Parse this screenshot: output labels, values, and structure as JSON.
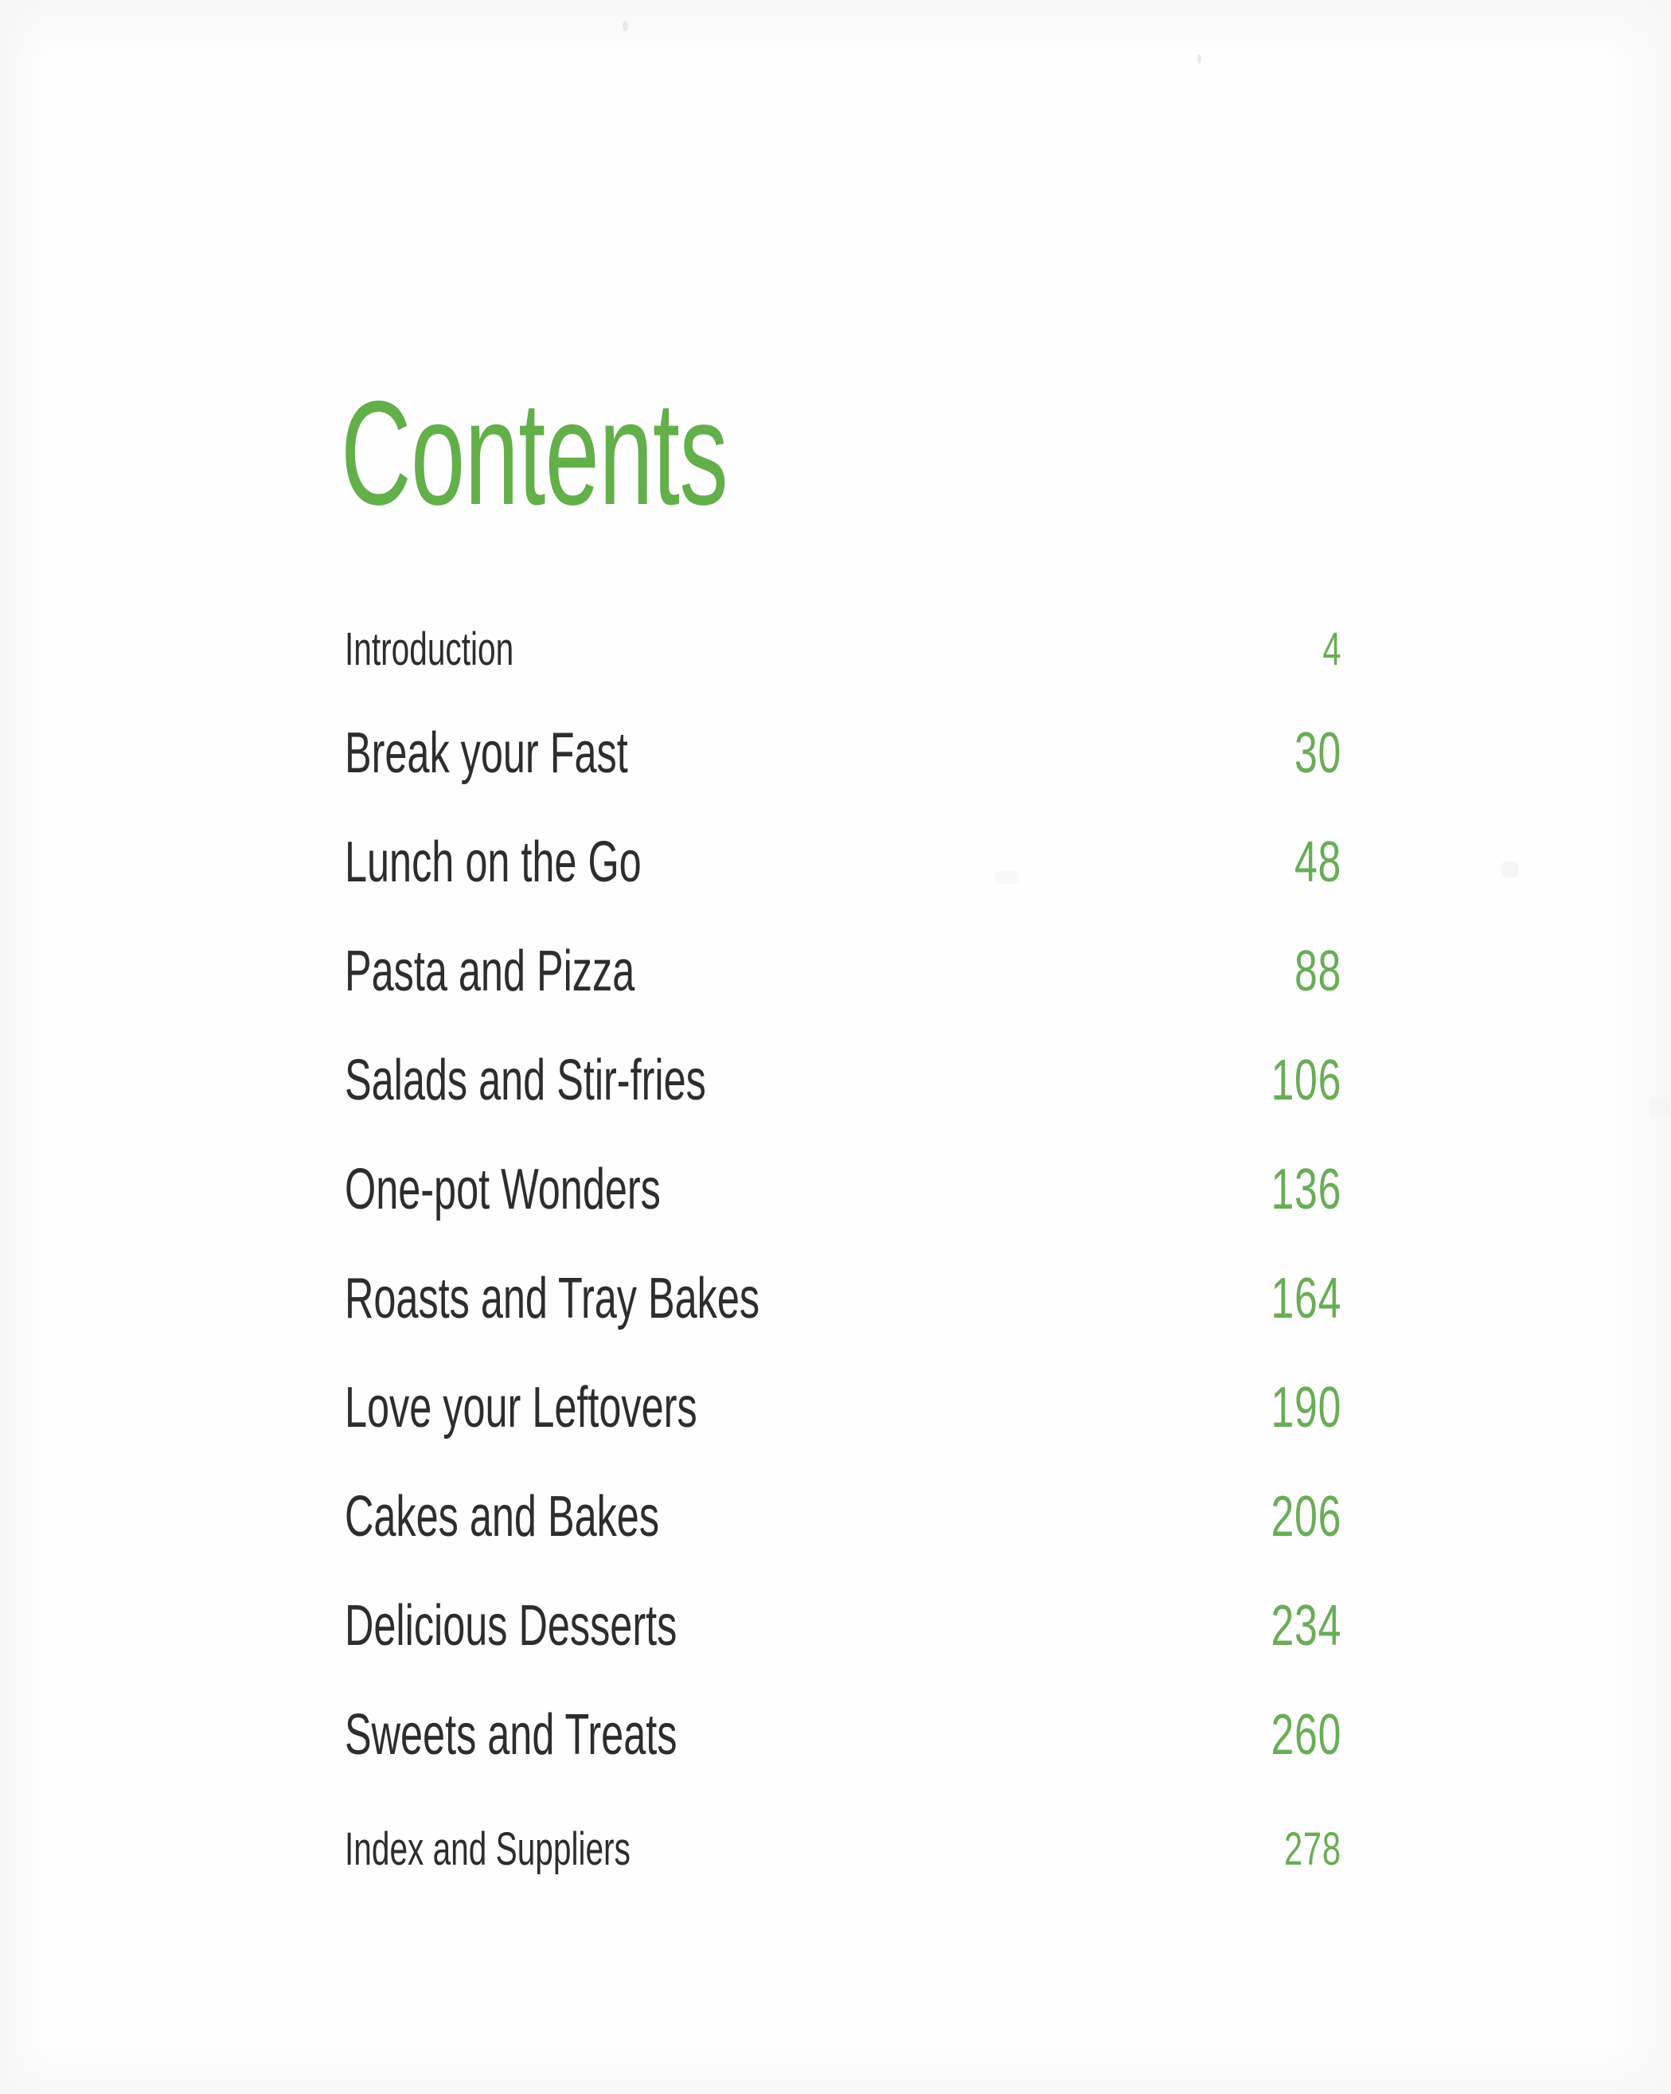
{
  "page": {
    "title": "Contents",
    "background_color": "#fefefe",
    "accent_color": "#63af4a",
    "number_color": "#69ad56",
    "text_color": "#2d2d2d"
  },
  "contents": {
    "heading": "Contents",
    "entries": [
      {
        "label": "Introduction",
        "page": "4",
        "emphasis": "small"
      },
      {
        "label": "Break your Fast",
        "page": "30",
        "emphasis": "large"
      },
      {
        "label": "Lunch on the Go",
        "page": "48",
        "emphasis": "large"
      },
      {
        "label": "Pasta and Pizza",
        "page": "88",
        "emphasis": "large"
      },
      {
        "label": "Salads and Stir-fries",
        "page": "106",
        "emphasis": "large"
      },
      {
        "label": "One-pot Wonders",
        "page": "136",
        "emphasis": "large"
      },
      {
        "label": "Roasts and Tray Bakes",
        "page": "164",
        "emphasis": "large"
      },
      {
        "label": "Love your Leftovers",
        "page": "190",
        "emphasis": "large"
      },
      {
        "label": "Cakes and Bakes",
        "page": "206",
        "emphasis": "large"
      },
      {
        "label": "Delicious Desserts",
        "page": "234",
        "emphasis": "large"
      },
      {
        "label": "Sweets and Treats",
        "page": "260",
        "emphasis": "large"
      },
      {
        "label": "Index and Suppliers",
        "page": "278",
        "emphasis": "small"
      }
    ]
  }
}
